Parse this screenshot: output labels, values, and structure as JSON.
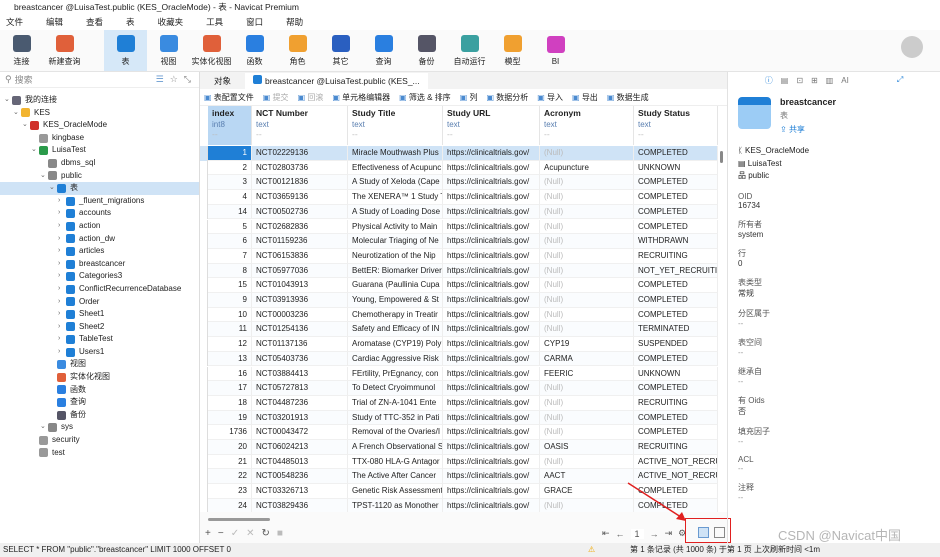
{
  "window": {
    "title": "breastcancer @LuisaTest.public (KES_OracleMode) - 表 - Navicat Premium"
  },
  "menu": [
    "文件",
    "编辑",
    "查看",
    "表",
    "收藏夹",
    "工具",
    "窗口",
    "帮助"
  ],
  "toolbar": [
    {
      "label": "连接",
      "icon": "connect-icon",
      "color": "#4a5a70"
    },
    {
      "label": "新建查询",
      "icon": "new-query-icon",
      "color": "#e0603a"
    },
    {
      "label": "表",
      "icon": "table-icon",
      "color": "#1f7fd6",
      "selected": true
    },
    {
      "label": "视图",
      "icon": "view-icon",
      "color": "#3a8be0"
    },
    {
      "label": "实体化视图",
      "icon": "materialized-view-icon",
      "color": "#e0603a"
    },
    {
      "label": "函数",
      "icon": "function-icon",
      "color": "#2a7fe0"
    },
    {
      "label": "角色",
      "icon": "role-icon",
      "color": "#f0a030"
    },
    {
      "label": "其它",
      "icon": "other-icon",
      "color": "#2a5fc0"
    },
    {
      "label": "查询",
      "icon": "query-icon",
      "color": "#2a7fe0"
    },
    {
      "label": "备份",
      "icon": "backup-icon",
      "color": "#556"
    },
    {
      "label": "自动运行",
      "icon": "automation-icon",
      "color": "#3aa0a0"
    },
    {
      "label": "模型",
      "icon": "model-icon",
      "color": "#f0a030"
    },
    {
      "label": "BI",
      "icon": "bi-icon",
      "color": "#d040c0"
    }
  ],
  "sidebar": {
    "search_placeholder": "搜索",
    "tree": [
      {
        "label": "我的连接",
        "depth": 0,
        "color": "#667"
      },
      {
        "label": "KES",
        "depth": 1,
        "color": "#f2b430"
      },
      {
        "label": "KES_OracleMode",
        "depth": 2,
        "color": "#d0302a"
      },
      {
        "label": "kingbase",
        "depth": 3,
        "color": "#999"
      },
      {
        "label": "LuisaTest",
        "depth": 3,
        "color": "#2a9a4a"
      },
      {
        "label": "dbms_sql",
        "depth": 4,
        "color": "#888"
      },
      {
        "label": "public",
        "depth": 4,
        "color": "#888"
      },
      {
        "label": "表",
        "depth": 5,
        "color": "#1f7fd6",
        "selected": true
      },
      {
        "label": "_fluent_migrations",
        "depth": 6,
        "color": "#1f7fd6"
      },
      {
        "label": "accounts",
        "depth": 6,
        "color": "#1f7fd6"
      },
      {
        "label": "action",
        "depth": 6,
        "color": "#1f7fd6"
      },
      {
        "label": "action_dw",
        "depth": 6,
        "color": "#1f7fd6"
      },
      {
        "label": "articles",
        "depth": 6,
        "color": "#1f7fd6"
      },
      {
        "label": "breastcancer",
        "depth": 6,
        "color": "#1f7fd6"
      },
      {
        "label": "Categories3",
        "depth": 6,
        "color": "#1f7fd6"
      },
      {
        "label": "ConflictRecurrenceDatabase",
        "depth": 6,
        "color": "#1f7fd6"
      },
      {
        "label": "Order",
        "depth": 6,
        "color": "#1f7fd6"
      },
      {
        "label": "Sheet1",
        "depth": 6,
        "color": "#1f7fd6"
      },
      {
        "label": "Sheet2",
        "depth": 6,
        "color": "#1f7fd6"
      },
      {
        "label": "TableTest",
        "depth": 6,
        "color": "#1f7fd6"
      },
      {
        "label": "Users1",
        "depth": 6,
        "color": "#1f7fd6"
      },
      {
        "label": "视图",
        "depth": 5,
        "color": "#3a8be0"
      },
      {
        "label": "实体化视图",
        "depth": 5,
        "color": "#e0603a"
      },
      {
        "label": "函数",
        "depth": 5,
        "color": "#2a7fe0"
      },
      {
        "label": "查询",
        "depth": 5,
        "color": "#2a7fe0"
      },
      {
        "label": "备份",
        "depth": 5,
        "color": "#556"
      },
      {
        "label": "sys",
        "depth": 4,
        "color": "#888"
      },
      {
        "label": "security",
        "depth": 3,
        "color": "#999"
      },
      {
        "label": "test",
        "depth": 3,
        "color": "#999"
      }
    ]
  },
  "tabs": {
    "objects": "对象",
    "active": "breastcancer @LuisaTest.public (KES_..."
  },
  "grid_toolbar": [
    "表配置文件",
    "提交",
    "回滚",
    "单元格编辑器",
    "筛选 & 排序",
    "列",
    "数据分析",
    "导入",
    "导出",
    "数据生成"
  ],
  "columns": [
    {
      "name": "index",
      "type": "int8"
    },
    {
      "name": "NCT Number",
      "type": "text"
    },
    {
      "name": "Study Title",
      "type": "text"
    },
    {
      "name": "Study URL",
      "type": "text"
    },
    {
      "name": "Acronym",
      "type": "text"
    },
    {
      "name": "Study Status",
      "type": "text"
    }
  ],
  "null_text": "(Null)",
  "rows": [
    [
      "1",
      "NCT02229136",
      "Miracle Mouthwash Plus",
      "https://clinicaltrials.gov/",
      null,
      "COMPLETED"
    ],
    [
      "2",
      "NCT02803736",
      "Effectiveness of Acupunc",
      "https://clinicaltrials.gov/",
      "Acupuncture",
      "UNKNOWN"
    ],
    [
      "3",
      "NCT00121836",
      "A Study of Xeloda (Cape",
      "https://clinicaltrials.gov/",
      null,
      "COMPLETED"
    ],
    [
      "4",
      "NCT03659136",
      "The XENERA™ 1 Study T",
      "https://clinicaltrials.gov/",
      null,
      "COMPLETED"
    ],
    [
      "14",
      "NCT00502736",
      "A Study of Loading Dose",
      "https://clinicaltrials.gov/",
      null,
      "COMPLETED"
    ],
    [
      "5",
      "NCT02682836",
      "Physical Activity to Main",
      "https://clinicaltrials.gov/",
      null,
      "COMPLETED"
    ],
    [
      "6",
      "NCT01159236",
      "Molecular Triaging of Ne",
      "https://clinicaltrials.gov/",
      null,
      "WITHDRAWN"
    ],
    [
      "7",
      "NCT06153836",
      "Neurotization of the Nip",
      "https://clinicaltrials.gov/",
      null,
      "RECRUITING"
    ],
    [
      "8",
      "NCT05977036",
      "BettER: Biomarker Driver",
      "https://clinicaltrials.gov/",
      null,
      "NOT_YET_RECRUITING"
    ],
    [
      "15",
      "NCT01043913",
      "Guarana (Paullinia Cupa",
      "https://clinicaltrials.gov/",
      null,
      "COMPLETED"
    ],
    [
      "9",
      "NCT03913936",
      "Young, Empowered & St",
      "https://clinicaltrials.gov/",
      null,
      "COMPLETED"
    ],
    [
      "10",
      "NCT00003236",
      "Chemotherapy in Treatir",
      "https://clinicaltrials.gov/",
      null,
      "COMPLETED"
    ],
    [
      "11",
      "NCT01254136",
      "Safety and Efficacy of IN",
      "https://clinicaltrials.gov/",
      null,
      "TERMINATED"
    ],
    [
      "12",
      "NCT01137136",
      "Aromatase (CYP19) Poly",
      "https://clinicaltrials.gov/",
      "CYP19",
      "SUSPENDED"
    ],
    [
      "13",
      "NCT05403736",
      "Cardiac Aggressive Risk",
      "https://clinicaltrials.gov/",
      "CARMA",
      "COMPLETED"
    ],
    [
      "16",
      "NCT03884413",
      "FErtility, PrEgnancy, con",
      "https://clinicaltrials.gov/",
      "FEERIC",
      "UNKNOWN"
    ],
    [
      "17",
      "NCT05727813",
      "To Detect Cryoimmunol",
      "https://clinicaltrials.gov/",
      null,
      "COMPLETED"
    ],
    [
      "18",
      "NCT04487236",
      "Trial of ZN-A-1041 Ente",
      "https://clinicaltrials.gov/",
      null,
      "RECRUITING"
    ],
    [
      "19",
      "NCT03201913",
      "Study of TTC-352 in Pati",
      "https://clinicaltrials.gov/",
      null,
      "COMPLETED"
    ],
    [
      "1736",
      "NCT00043472",
      "Removal of the Ovaries/I",
      "https://clinicaltrials.gov/",
      null,
      "COMPLETED"
    ],
    [
      "20",
      "NCT06024213",
      "A French Observational S",
      "https://clinicaltrials.gov/",
      "OASIS",
      "RECRUITING"
    ],
    [
      "21",
      "NCT04485013",
      "TTX-080 HLA-G Antagor",
      "https://clinicaltrials.gov/",
      null,
      "ACTIVE_NOT_RECRUITING"
    ],
    [
      "22",
      "NCT00548236",
      "The Active After Cancer",
      "https://clinicaltrials.gov/",
      "AACT",
      "ACTIVE_NOT_RECRUITING"
    ],
    [
      "23",
      "NCT03326713",
      "Genetic Risk Assessment",
      "https://clinicaltrials.gov/",
      "GRACE",
      "COMPLETED"
    ],
    [
      "24",
      "NCT03829436",
      "TPST-1120 as Monother",
      "https://clinicaltrials.gov/",
      null,
      "COMPLETED"
    ]
  ],
  "pager": {
    "page": "1"
  },
  "status": {
    "sql": "SELECT * FROM \"public\".\"breastcancer\" LIMIT 1000 OFFSET 0",
    "info": "第 1 条记录 (共 1000 条) 于第 1 页 上次刷新时间 <1m"
  },
  "watermark": "CSDN @Navicat中国",
  "panel": {
    "name": "breastcancer",
    "kind": "表",
    "share": "共享",
    "connection": "KES_OracleMode",
    "database": "LuisaTest",
    "schema": "public",
    "props": [
      {
        "label": "OID",
        "value": "16734"
      },
      {
        "label": "所有者",
        "value": "system"
      },
      {
        "label": "行",
        "value": "0"
      },
      {
        "label": "表类型",
        "value": "常规"
      },
      {
        "label": "分区属于",
        "value": "--"
      },
      {
        "label": "表空间",
        "value": "--"
      },
      {
        "label": "继承自",
        "value": "--"
      },
      {
        "label": "有 Oids",
        "value": "否"
      },
      {
        "label": "填充因子",
        "value": "--"
      },
      {
        "label": "ACL",
        "value": "--"
      },
      {
        "label": "注释",
        "value": "--"
      }
    ]
  },
  "accent": "#1f7fd6",
  "selection": "#cfe3f6",
  "highlight_box": "#e02020"
}
